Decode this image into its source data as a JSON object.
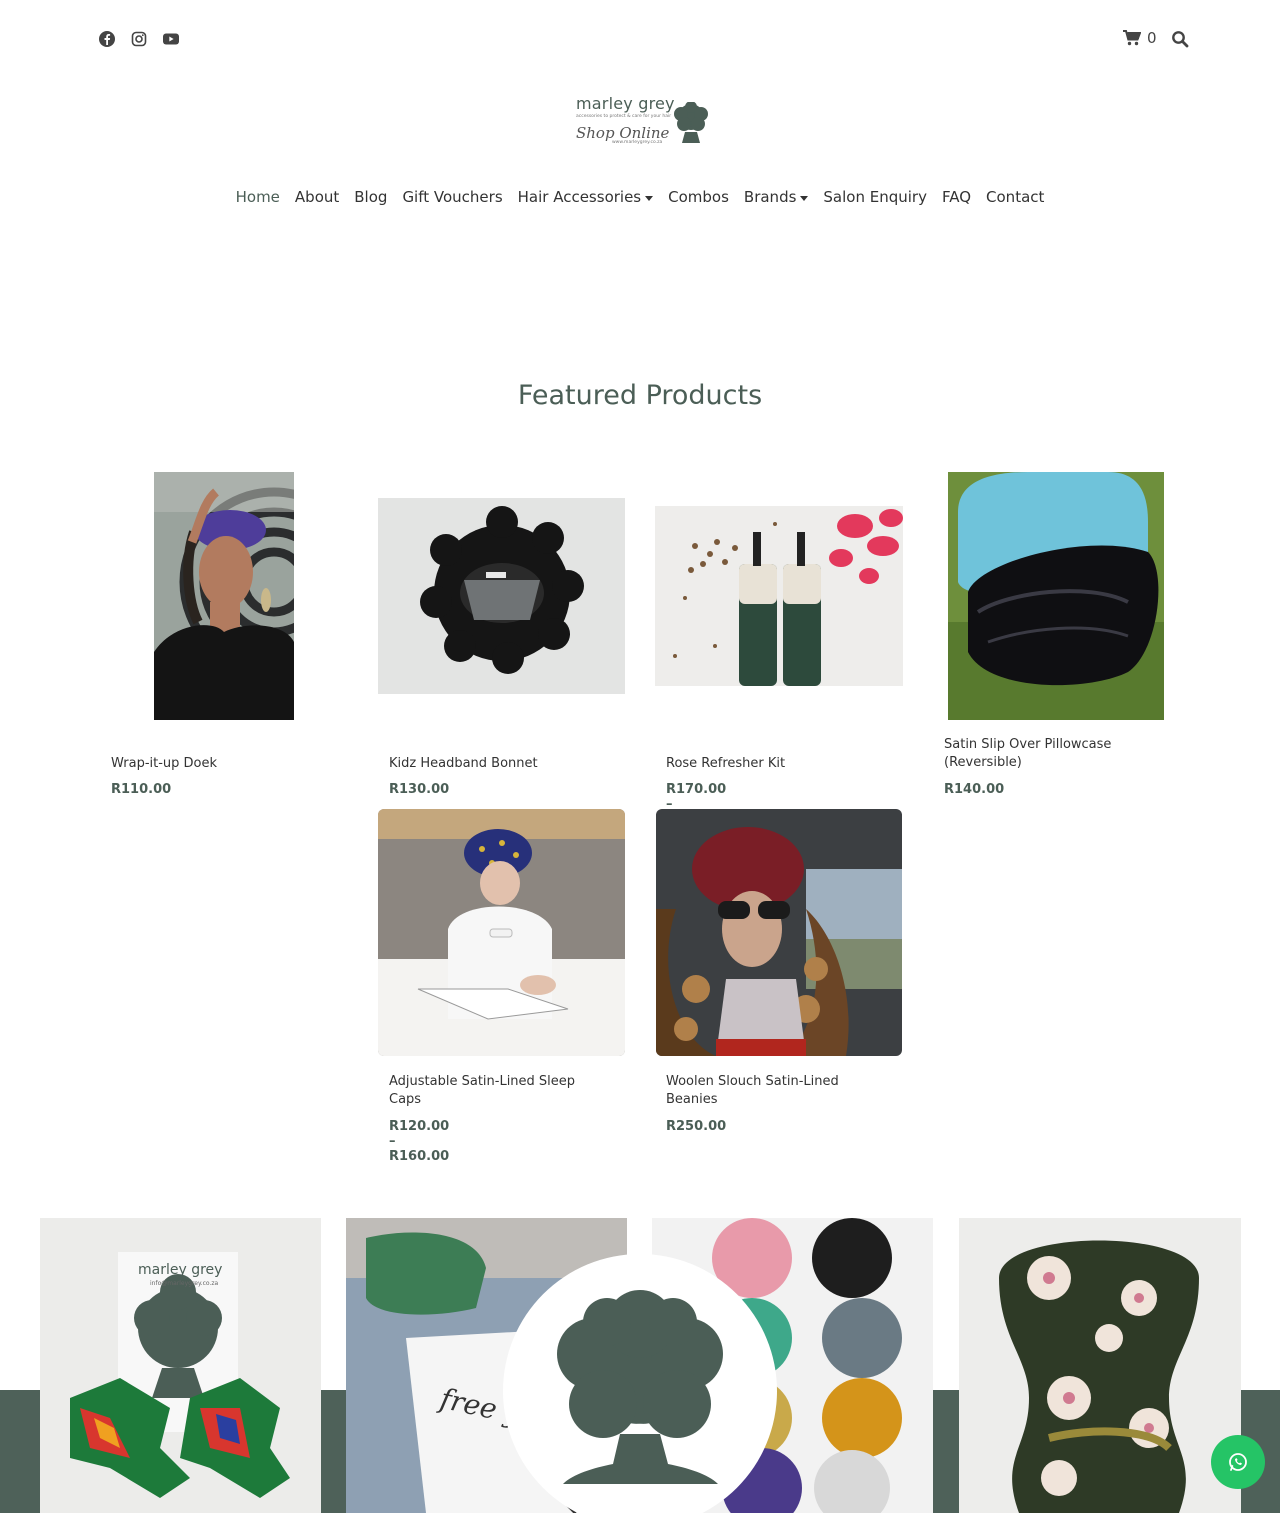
{
  "header": {
    "social": [
      "facebook-icon",
      "instagram-icon",
      "youtube-icon"
    ],
    "cart_count": "0"
  },
  "logo": {
    "brand": "marley grey",
    "tagline": "accessories to protect & care for your hair",
    "script": "Shop Online",
    "url": "www.marleygrey.co.za"
  },
  "nav": {
    "items": [
      {
        "label": "Home"
      },
      {
        "label": "About"
      },
      {
        "label": "Blog"
      },
      {
        "label": "Gift Vouchers"
      },
      {
        "label": "Hair Accessories"
      },
      {
        "label": "Combos"
      },
      {
        "label": "Brands"
      },
      {
        "label": "Salon Enquiry"
      },
      {
        "label": "FAQ"
      },
      {
        "label": "Contact"
      }
    ]
  },
  "featured": {
    "title": "Featured Products",
    "products": [
      {
        "name": "Wrap-it-up Doek",
        "price": "R110.00"
      },
      {
        "name": "Kidz Headband Bonnet",
        "price": "R130.00"
      },
      {
        "name": "Rose Refresher Kit",
        "price": "R170.00 – R315.00"
      },
      {
        "name": "Satin Slip Over Pillowcase (Reversible)",
        "price": "R140.00"
      },
      {
        "name": "Adjustable Satin-Lined Sleep Caps",
        "price": "R120.00 – R160.00"
      },
      {
        "name": "Woolen Slouch Satin-Lined Beanies",
        "price": "R250.00"
      }
    ]
  },
  "gallery": {
    "card_brand": "marley grey",
    "card_email": "info@marleygrey.co.za",
    "tee_text": "free y"
  },
  "colors": {
    "accent": "#4b5e56",
    "band": "#4e6159",
    "whatsapp": "#25c466"
  }
}
